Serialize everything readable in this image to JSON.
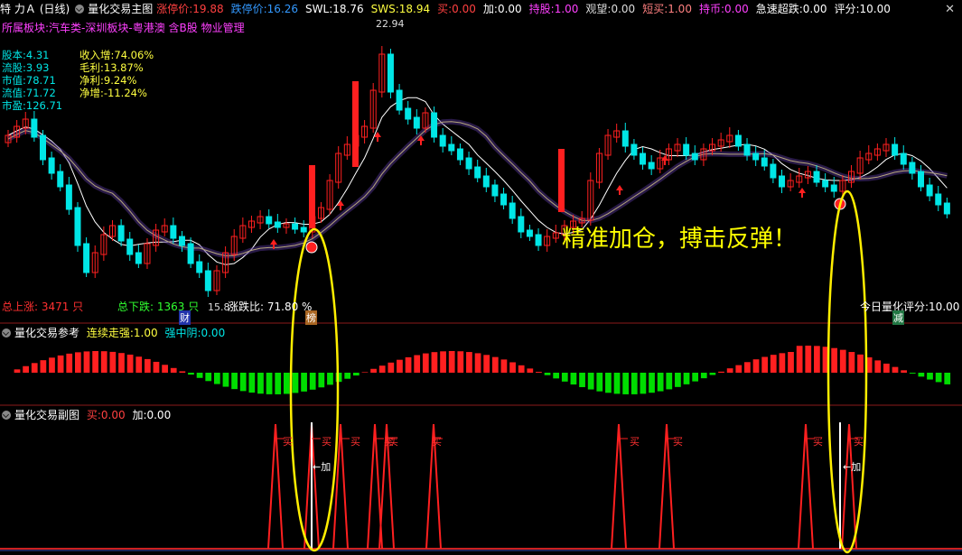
{
  "header": {
    "stock": "特 力Ａ",
    "period": "(日线)",
    "indicator": "量化交易主图",
    "fields": [
      {
        "label": "涨停价:",
        "value": "19.88",
        "color": "#ff4040"
      },
      {
        "label": "跌停价:",
        "value": "16.26",
        "color": "#3399ff"
      },
      {
        "label": "SWL:",
        "value": "18.76",
        "color": "#ffffff"
      },
      {
        "label": "SWS:",
        "value": "18.94",
        "color": "#ffff40"
      },
      {
        "label": "买:",
        "value": "0.00",
        "color": "#ff4040"
      },
      {
        "label": "加:",
        "value": "0.00",
        "color": "#ffffff"
      },
      {
        "label": "持股:",
        "value": "1.00",
        "color": "#ff40ff"
      },
      {
        "label": "观望:",
        "value": "0.00",
        "color": "#dddddd"
      },
      {
        "label": "短买:",
        "value": "1.00",
        "color": "#ff8080"
      },
      {
        "label": "持币:",
        "value": "0.00",
        "color": "#ff40ff"
      },
      {
        "label": "急速超跌:",
        "value": "0.00",
        "color": "#ffffff"
      },
      {
        "label": "评分:",
        "value": "10.00",
        "color": "#ffffff"
      }
    ],
    "sector": "所属板块:汽车类-深圳板块-粤港澳 含B股 物业管理"
  },
  "fundamentals": {
    "left": [
      "股本:4.31",
      "流股:3.93",
      "市值:78.71",
      "流值:71.72",
      "市盈:126.71"
    ],
    "right": [
      "收入增:74.06%",
      "毛利:13.87%",
      "净利:9.24%",
      "净增:-11.24%"
    ]
  },
  "annotations": {
    "high": "22.94",
    "low": "15.8",
    "slogan": "精准加仓，搏击反弹！",
    "total_up": "总上涨:  3471 只",
    "total_down": "总下跌:  1363 只",
    "ratio": "涨跌比:  71.80 %",
    "score": "今日量化评分:10.00",
    "tag_cai": "财",
    "tag_bang": "榜",
    "tag_jian": "减",
    "buy": "买",
    "add": "加"
  },
  "ref_panel": {
    "title": "量化交易参考",
    "field1_label": "连续走强:",
    "field1_value": "1.00",
    "field2_label": "强中阴:",
    "field2_value": "0.00"
  },
  "sub_panel": {
    "title": "量化交易副图",
    "buy_label": "买:",
    "buy_value": "0.00",
    "add_label": "加:",
    "add_value": "0.00"
  },
  "colors": {
    "up": "#ff2020",
    "down": "#00e6e6",
    "slogan": "#ffff00",
    "ellipse": "#ffee00"
  }
}
